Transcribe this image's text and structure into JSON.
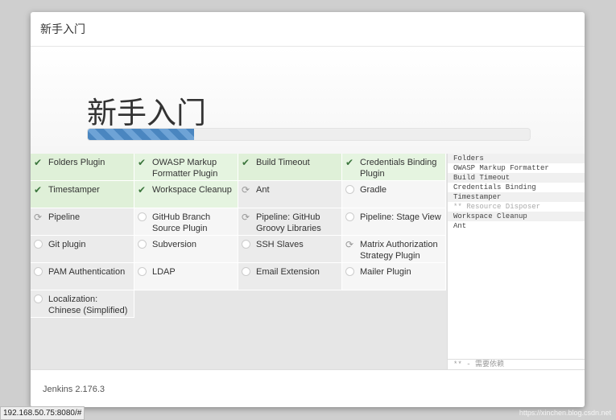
{
  "header": {
    "title": "新手入门"
  },
  "hero": {
    "title": "新手入门",
    "progress_percent": 24
  },
  "plugins": [
    {
      "name": "Folders Plugin",
      "state": "success"
    },
    {
      "name": "OWASP Markup Formatter Plugin",
      "state": "success"
    },
    {
      "name": "Build Timeout",
      "state": "success"
    },
    {
      "name": "Credentials Binding Plugin",
      "state": "success"
    },
    {
      "name": "Timestamper",
      "state": "success"
    },
    {
      "name": "Workspace Cleanup",
      "state": "success"
    },
    {
      "name": "Ant",
      "state": "installing"
    },
    {
      "name": "Gradle",
      "state": "pending"
    },
    {
      "name": "Pipeline",
      "state": "installing"
    },
    {
      "name": "GitHub Branch Source Plugin",
      "state": "pending"
    },
    {
      "name": "Pipeline: GitHub Groovy Libraries",
      "state": "installing"
    },
    {
      "name": "Pipeline: Stage View",
      "state": "pending"
    },
    {
      "name": "Git plugin",
      "state": "pending"
    },
    {
      "name": "Subversion",
      "state": "pending"
    },
    {
      "name": "SSH Slaves",
      "state": "pending"
    },
    {
      "name": "Matrix Authorization Strategy Plugin",
      "state": "installing"
    },
    {
      "name": "PAM Authentication",
      "state": "pending"
    },
    {
      "name": "LDAP",
      "state": "pending"
    },
    {
      "name": "Email Extension",
      "state": "pending"
    },
    {
      "name": "Mailer Plugin",
      "state": "pending"
    },
    {
      "name": "Localization: Chinese (Simplified)",
      "state": "pending"
    }
  ],
  "log": [
    "Folders",
    "OWASP Markup Formatter",
    "Build Timeout",
    "Credentials Binding",
    "Timestamper",
    "** Resource Disposer",
    "Workspace Cleanup",
    "Ant"
  ],
  "log_legend": "** - 需要依赖",
  "footer": {
    "version": "Jenkins 2.176.3"
  },
  "statusbar": {
    "url": "192.168.50.75:8080/#"
  },
  "watermark": "https://xinchen.blog.csdn.net"
}
